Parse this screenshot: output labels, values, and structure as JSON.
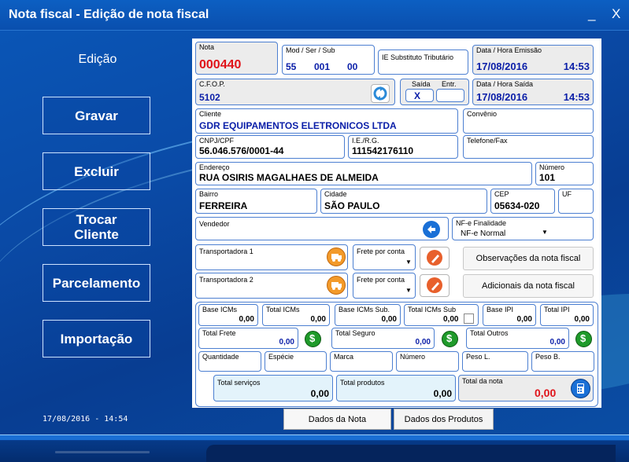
{
  "window": {
    "title": "Nota fiscal - Edição de nota fiscal",
    "minimize": "_",
    "close": "X"
  },
  "sidebar": {
    "mode": "Edição",
    "buttons": [
      "Gravar",
      "Excluir",
      "Trocar Cliente",
      "Parcelamento",
      "Importação"
    ],
    "datetime": "17/08/2016 - 14:54"
  },
  "form": {
    "nota": {
      "label": "Nota",
      "value": "000440"
    },
    "mod_ser_sub": {
      "label": "Mod / Ser / Sub",
      "mod": "55",
      "ser": "001",
      "sub": "00"
    },
    "ie_st": {
      "label": "IE Substituto Tributário"
    },
    "emissao": {
      "label": "Data / Hora Emissão",
      "date": "17/08/2016",
      "time": "14:53"
    },
    "cfop": {
      "label": "C.F.O.P.",
      "value": "5102"
    },
    "saida_entrada": {
      "saida_label": "Saída",
      "entrada_label": "Entr.",
      "saida_value": "X",
      "entrada_value": ""
    },
    "saida": {
      "label": "Data / Hora Saída",
      "date": "17/08/2016",
      "time": "14:53"
    },
    "cliente": {
      "label": "Cliente",
      "value": "GDR EQUIPAMENTOS ELETRONICOS LTDA"
    },
    "convenio": {
      "label": "Convênio",
      "value": ""
    },
    "cnpj": {
      "label": "CNPJ/CPF",
      "value": "56.046.576/0001-44"
    },
    "ie_rg": {
      "label": "I.E./R.G.",
      "value": "111542176110"
    },
    "telefone": {
      "label": "Telefone/Fax",
      "value": ""
    },
    "endereco": {
      "label": "Endereço",
      "value": "RUA OSIRIS MAGALHAES DE ALMEIDA"
    },
    "numero": {
      "label": "Número",
      "value": "101"
    },
    "bairro": {
      "label": "Bairro",
      "value": "FERREIRA"
    },
    "cidade": {
      "label": "Cidade",
      "value": "SÃO PAULO"
    },
    "cep": {
      "label": "CEP",
      "value": "05634-020"
    },
    "uf": {
      "label": "UF",
      "value": ""
    },
    "vendedor": {
      "label": "Vendedor",
      "value": ""
    },
    "finalidade": {
      "label": "NF-e Finalidade",
      "value": "NF-e Normal"
    },
    "transportadora1": {
      "label": "Transportadora 1",
      "frete_label": "Frete por conta"
    },
    "transportadora2": {
      "label": "Transportadora 2",
      "frete_label": "Frete por conta"
    },
    "obs_button": "Observações da nota fiscal",
    "adicionais_button": "Adicionais da nota fiscal",
    "totais": {
      "base_icms": {
        "label": "Base ICMs",
        "value": "0,00"
      },
      "total_icms": {
        "label": "Total ICMs",
        "value": "0,00"
      },
      "base_icms_sub": {
        "label": "Base ICMs Sub.",
        "value": "0,00"
      },
      "total_icms_sub": {
        "label": "Total ICMs Sub",
        "value": "0,00"
      },
      "base_ipi": {
        "label": "Base IPI",
        "value": "0,00"
      },
      "total_ipi": {
        "label": "Total IPI",
        "value": "0,00"
      },
      "total_frete": {
        "label": "Total Frete",
        "value": "0,00"
      },
      "total_seguro": {
        "label": "Total Seguro",
        "value": "0,00"
      },
      "total_outros": {
        "label": "Total Outros",
        "value": "0,00"
      },
      "dollar_icon": "$",
      "quantidade": {
        "label": "Quantidade"
      },
      "especie": {
        "label": "Espécie"
      },
      "marca": {
        "label": "Marca"
      },
      "numero_vol": {
        "label": "Número"
      },
      "peso_l": {
        "label": "Peso L."
      },
      "peso_b": {
        "label": "Peso B."
      },
      "total_servicos": {
        "label": "Total serviços",
        "value": "0,00"
      },
      "total_produtos": {
        "label": "Total produtos",
        "value": "0,00"
      },
      "total_nota": {
        "label": "Total da nota",
        "value": "0,00"
      }
    }
  },
  "tabs": [
    "Dados da Nota",
    "Dados dos Produtos"
  ],
  "colors": {
    "accent": "#0a1ea8",
    "total": "#e0141a",
    "border": "#4c7fd1",
    "sidebar_bg": "#0a4aa6"
  }
}
